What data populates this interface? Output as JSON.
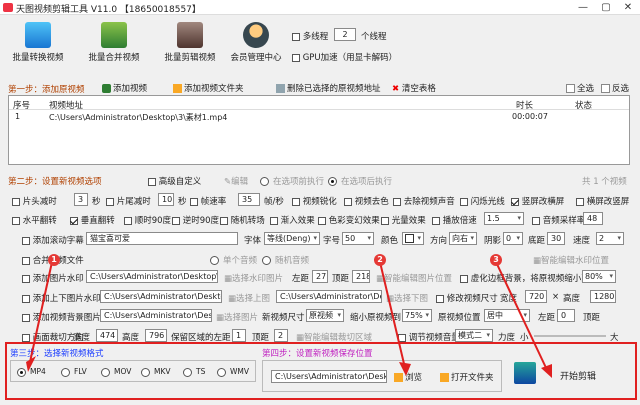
{
  "titlebar": {
    "title": "天图视频剪辑工具 V11.0 【18650018557】",
    "min": "—",
    "max": "▢",
    "close": "✕"
  },
  "toolbar": {
    "items": [
      {
        "label": "批量转换视频"
      },
      {
        "label": "批量合并视频"
      },
      {
        "label": "批量剪辑视频"
      },
      {
        "label": "会员管理中心"
      }
    ],
    "multithread": "多线程",
    "threads": "2",
    "thread_unit": "个线程",
    "gpu": "GPU加速（用显卡解码）"
  },
  "step1": {
    "title": "第一步：添加原视频",
    "add": "添加视频",
    "add_folder": "添加视频文件夹",
    "delete": "删除已选择的原视频地址",
    "clear": "清空表格",
    "select_all": "全选",
    "invert": "反选",
    "columns": [
      "序号",
      "视频地址",
      "时长",
      "状态"
    ],
    "rows": [
      {
        "no": "1",
        "path": "C:\\Users\\Administrator\\Desktop\\3\\素材1.mp4",
        "duration": "00:00:07",
        "status": ""
      }
    ]
  },
  "step2": {
    "title": "第二步：设置新视频选项",
    "adv": "高级自定义",
    "edit": "编辑",
    "exec_before": "在选项前执行",
    "exec_after": "在选项后执行",
    "count": "共 1 个视频"
  },
  "row1": {
    "cut_head": "片头减时",
    "cut_head_val": "3",
    "sec": "秒",
    "cut_tail": "片尾减时",
    "cut_tail_val": "10",
    "sec2": "秒",
    "fps": "帧速率",
    "fps_val": "35",
    "fps_unit": "帧/秒",
    "sharpen": "视频锐化",
    "decolor": "视频去色",
    "mute": "去除视频声音",
    "flash": "闪烁光线",
    "vert": "竖屏改横屏",
    "horiz": "横屏改竖屏"
  },
  "row2": {
    "hflip": "水平翻转",
    "vflip": "垂直翻转",
    "rot90": "顺时90度",
    "rot90b": "逆时90度",
    "rand": "随机转场",
    "fade": "渐入效果",
    "color": "色彩变幻效果",
    "light": "光量效果",
    "speed": "播放倍速",
    "speed_val": "1.5",
    "sample": "音频采样率",
    "sample_val": "48"
  },
  "row3": {
    "subtitle": "添加滚动字幕",
    "subtitle_val": "猫宝喜可爱",
    "font": "字体",
    "font_val": "等线(Deng)",
    "size": "字号",
    "size_val": "50",
    "color": "颜色",
    "dir": "方向",
    "dir_val": "向右",
    "shadow": "阴影",
    "shadow_val": "0",
    "bottom": "底距",
    "bottom_val": "30",
    "speed": "速度",
    "speed_val": "2"
  },
  "row4": {
    "merge_audio": "合并音频文件",
    "single": "单个音频",
    "random_audio": "随机音频",
    "smart_pos": "智能编辑水印位置"
  },
  "row5": {
    "watermark": "添加图片水印",
    "wm_path": "C:\\Users\\Administrator\\Desktop\\AAA\\图",
    "wm_select": "选择水印图片",
    "left": "左距",
    "left_val": "27",
    "top": "顶距",
    "top_val": "218",
    "smart": "智能编辑图片位置",
    "blur": "虚化边框背景，将原视频缩小到",
    "blur_val": "80%"
  },
  "row6": {
    "overlay": "添加上下图片水印",
    "ov_path": "C:\\Users\\Administrator\\Desktop\\",
    "ov_up": "选择上图",
    "ov_path2": "C:\\Users\\Administrator\\Desk",
    "ov_down": "选择下图",
    "resize": "修改视频尺寸",
    "width": "宽度",
    "width_val": "720",
    "x": "×",
    "height": "高度",
    "height_val": "1280"
  },
  "row7": {
    "bg": "添加视频背景图片",
    "bg_path": "C:\\Users\\Administrator\\Desktop\\",
    "bg_select": "选择图片",
    "bg_size": "新视频尺寸",
    "bg_size_val": "原视频",
    "shrink": "缩小原视频到",
    "shrink_val": "75%",
    "pos": "原视频位置",
    "pos_val": "居中",
    "left": "左距",
    "left_val": "0",
    "top": "顶距"
  },
  "row8": {
    "crop": "画面裁切方向",
    "width": "宽度",
    "width_val": "474",
    "height": "高度",
    "height_val": "796",
    "keep": "保留区域的左距",
    "keep_val": "1",
    "top": "顶距",
    "top_val": "2",
    "smart": "智能编辑裁切区域",
    "vol": "调节视频音量",
    "mode": "模式二",
    "force": "力度",
    "force_val": "小",
    "big": "大"
  },
  "step3": {
    "title": "第三步：选择新视频格式",
    "formats": [
      "MP4",
      "FLV",
      "MOV",
      "MKV",
      "TS",
      "WMV"
    ]
  },
  "step4": {
    "title": "第四步：设置新视频保存位置",
    "path": "C:\\Users\\Administrator\\Desktop",
    "browse": "浏览",
    "open": "打开文件夹",
    "start": "开始剪辑"
  },
  "badges": [
    "1",
    "2",
    "3"
  ],
  "colors": {
    "accent": "#1a3cff",
    "section": "#b04000",
    "highlight": "#e02020"
  }
}
